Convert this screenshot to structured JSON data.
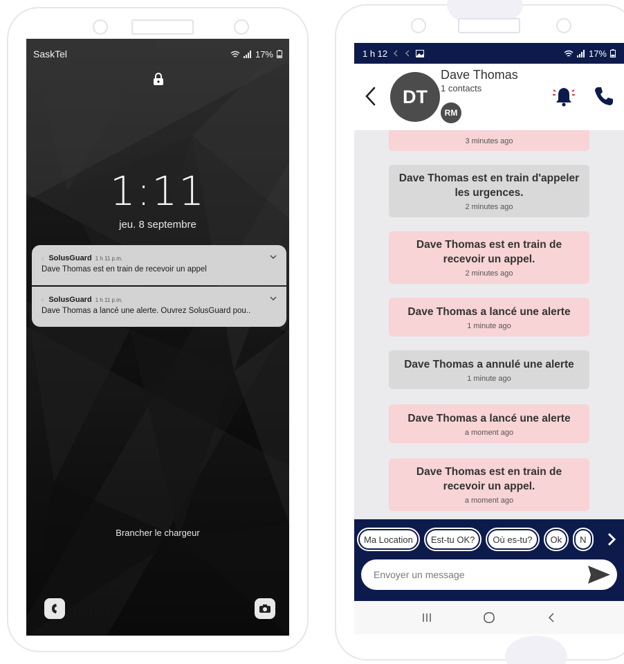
{
  "lock_screen": {
    "carrier": "SaskTel",
    "battery": "17%",
    "time": "1:11",
    "date": "jeu. 8 septembre",
    "notifications": [
      {
        "app": "SolusGuard",
        "time": "1 h 11 p.m.",
        "body": "Dave Thomas est en train de recevoir un appel"
      },
      {
        "app": "SolusGuard",
        "time": "1 h 11 p.m.",
        "body": "Dave Thomas a lancé une alerte. Ouvrez SolusGuard pou.."
      }
    ],
    "charger_text": "Brancher le chargeur",
    "icons": {
      "lock": "lock-icon",
      "phone_shortcut": "phone-icon",
      "camera_shortcut": "camera-icon"
    }
  },
  "chat": {
    "status": {
      "time": "1 h 12",
      "battery": "17%"
    },
    "contact_name": "Dave Thomas",
    "contact_sub": "1 contacts",
    "avatar_initials": "DT",
    "member_initials": "RM",
    "messages": [
      {
        "text": "",
        "time": "3 minutes ago",
        "color": "pink"
      },
      {
        "text": "Dave Thomas est en train d'appeler les urgences.",
        "time": "2 minutes ago",
        "color": "grey"
      },
      {
        "text": "Dave Thomas est en train de recevoir un appel.",
        "time": "2 minutes ago",
        "color": "pink"
      },
      {
        "text": "Dave Thomas a lancé une alerte",
        "time": "1 minute ago",
        "color": "pink"
      },
      {
        "text": "Dave Thomas a annulé une alerte",
        "time": "1 minute ago",
        "color": "grey"
      },
      {
        "text": "Dave Thomas a lancé une alerte",
        "time": "a moment ago",
        "color": "pink"
      },
      {
        "text": "Dave Thomas est en train de recevoir un appel.",
        "time": "a moment ago",
        "color": "pink"
      }
    ],
    "quick_replies": [
      "Ma Location",
      "Est-tu OK?",
      "Où es-tu?",
      "Ok",
      "N"
    ],
    "input_placeholder": "Envoyer un message",
    "colors": {
      "navy": "#0d1b4c",
      "alert_pink": "#f8d4d6",
      "neutral_grey": "#d9d9d9",
      "bell_red": "#e23a3a"
    }
  }
}
